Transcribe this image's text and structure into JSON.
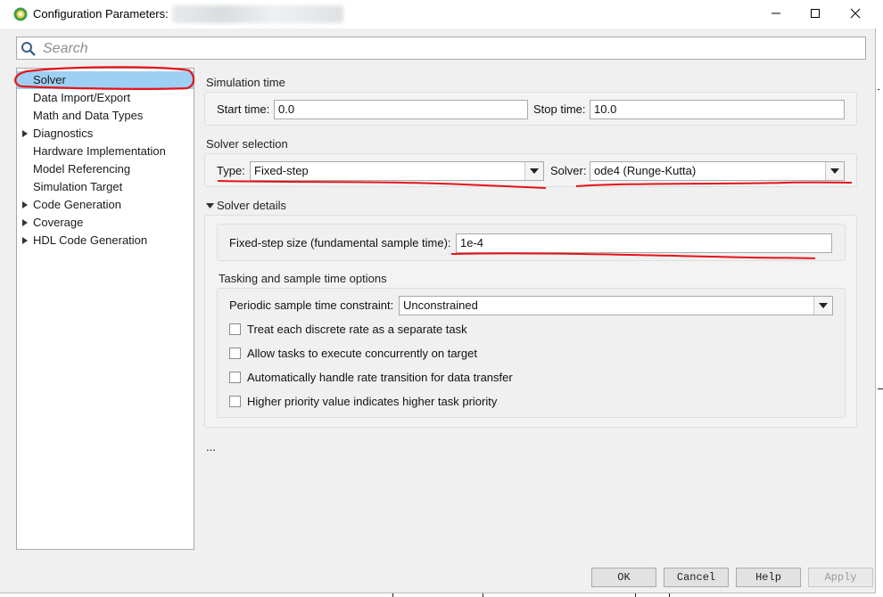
{
  "window": {
    "title": "Configuration Parameters:",
    "controls": {
      "minimize": "minimize",
      "maximize": "maximize",
      "close": "close"
    }
  },
  "search": {
    "placeholder": "Search"
  },
  "sidebar": {
    "items": [
      {
        "label": "Solver",
        "expandable": false,
        "selected": true
      },
      {
        "label": "Data Import/Export",
        "expandable": false
      },
      {
        "label": "Math and Data Types",
        "expandable": false
      },
      {
        "label": "Diagnostics",
        "expandable": true
      },
      {
        "label": "Hardware Implementation",
        "expandable": false
      },
      {
        "label": "Model Referencing",
        "expandable": false
      },
      {
        "label": "Simulation Target",
        "expandable": false
      },
      {
        "label": "Code Generation",
        "expandable": true
      },
      {
        "label": "Coverage",
        "expandable": true
      },
      {
        "label": "HDL Code Generation",
        "expandable": true
      }
    ]
  },
  "simulation_time": {
    "title": "Simulation time",
    "start_label": "Start time:",
    "start_value": "0.0",
    "stop_label": "Stop time:",
    "stop_value": "10.0"
  },
  "solver_selection": {
    "title": "Solver selection",
    "type_label": "Type:",
    "type_value": "Fixed-step",
    "solver_label": "Solver:",
    "solver_value": "ode4 (Runge-Kutta)"
  },
  "solver_details": {
    "title": "Solver details",
    "step_label": "Fixed-step size (fundamental sample time):",
    "step_value": "1e-4"
  },
  "tasking": {
    "title": "Tasking and sample time options",
    "constraint_label": "Periodic sample time constraint:",
    "constraint_value": "Unconstrained",
    "options": [
      {
        "label": "Treat each discrete rate as a separate task",
        "checked": false
      },
      {
        "label": "Allow tasks to execute concurrently on target",
        "checked": false
      },
      {
        "label": "Automatically handle rate transition for data transfer",
        "checked": false
      },
      {
        "label": "Higher priority value indicates higher task priority",
        "checked": false
      }
    ]
  },
  "ellipsis": "...",
  "buttons": {
    "ok": "OK",
    "cancel": "Cancel",
    "help": "Help",
    "apply": "Apply"
  },
  "colors": {
    "selection": "#9ed0f5",
    "annotation": "#e5141b"
  }
}
